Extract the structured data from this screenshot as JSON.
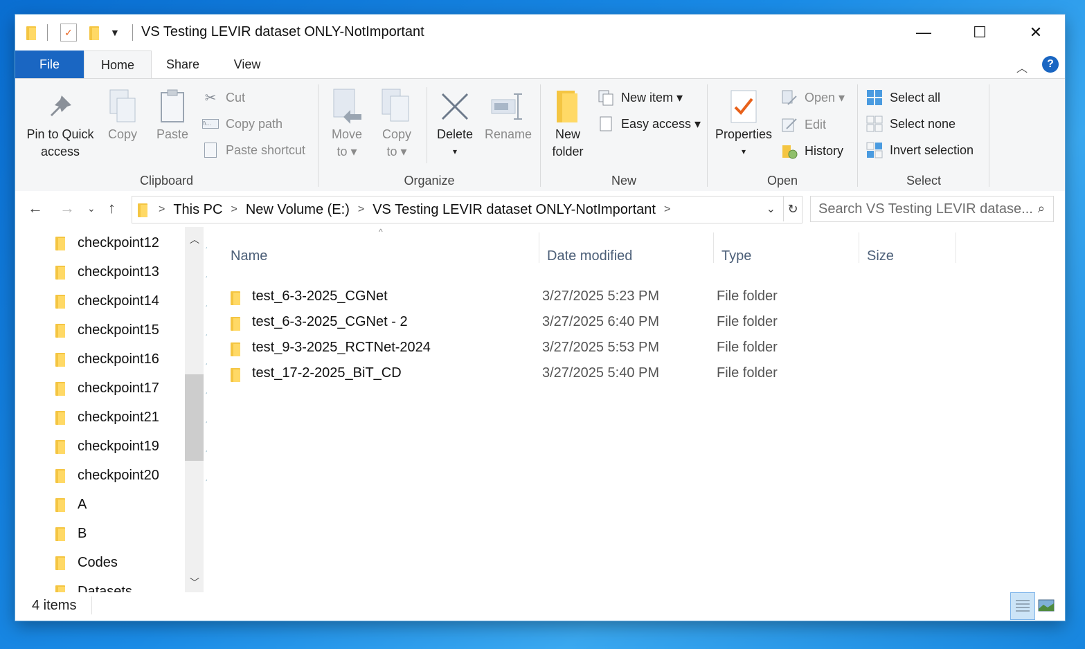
{
  "window": {
    "title": "VS Testing LEVIR dataset ONLY-NotImportant",
    "controls": {
      "minimize": "—",
      "maximize": "☐",
      "close": "✕"
    }
  },
  "tabs": {
    "file": "File",
    "home": "Home",
    "share": "Share",
    "view": "View",
    "help": "?"
  },
  "ribbon": {
    "clipboard": {
      "label": "Clipboard",
      "pin_line1": "Pin to Quick",
      "pin_line2": "access",
      "copy": "Copy",
      "paste": "Paste",
      "cut": "Cut",
      "copy_path": "Copy path",
      "paste_shortcut": "Paste shortcut"
    },
    "organize": {
      "label": "Organize",
      "move_line1": "Move",
      "move_line2": "to ▾",
      "copy_line1": "Copy",
      "copy_line2": "to ▾",
      "delete_line1": "Delete",
      "delete_line2": "▾",
      "rename": "Rename"
    },
    "new": {
      "label": "New",
      "new_folder_line1": "New",
      "new_folder_line2": "folder",
      "new_item": "New item ▾",
      "easy_access": "Easy access ▾"
    },
    "open": {
      "label": "Open",
      "properties_line1": "Properties",
      "properties_line2": "▾",
      "open": "Open ▾",
      "edit": "Edit",
      "history": "History"
    },
    "select": {
      "label": "Select",
      "select_all": "Select all",
      "select_none": "Select none",
      "invert": "Invert selection"
    }
  },
  "address": {
    "crumbs": [
      "This PC",
      "New Volume (E:)",
      "VS Testing LEVIR dataset ONLY-NotImportant"
    ],
    "search_placeholder": "Search VS Testing LEVIR datase..."
  },
  "navpane": {
    "items": [
      {
        "label": "checkpoint12",
        "pinned": true
      },
      {
        "label": "checkpoint13",
        "pinned": true
      },
      {
        "label": "checkpoint14",
        "pinned": true
      },
      {
        "label": "checkpoint15",
        "pinned": true
      },
      {
        "label": "checkpoint16",
        "pinned": true
      },
      {
        "label": "checkpoint17",
        "pinned": true
      },
      {
        "label": "checkpoint21",
        "pinned": true
      },
      {
        "label": "checkpoint19",
        "pinned": true
      },
      {
        "label": "checkpoint20",
        "pinned": true
      },
      {
        "label": "A",
        "pinned": false
      },
      {
        "label": "B",
        "pinned": false
      },
      {
        "label": "Codes",
        "pinned": false
      },
      {
        "label": "Datasets",
        "pinned": false
      }
    ]
  },
  "columns": {
    "name": "Name",
    "date": "Date modified",
    "type": "Type",
    "size": "Size"
  },
  "files": [
    {
      "name": "test_6-3-2025_CGNet",
      "date": "3/27/2025 5:23 PM",
      "type": "File folder",
      "size": ""
    },
    {
      "name": "test_6-3-2025_CGNet - 2",
      "date": "3/27/2025 6:40 PM",
      "type": "File folder",
      "size": ""
    },
    {
      "name": "test_9-3-2025_RCTNet-2024",
      "date": "3/27/2025 5:53 PM",
      "type": "File folder",
      "size": ""
    },
    {
      "name": "test_17-2-2025_BiT_CD",
      "date": "3/27/2025 5:40 PM",
      "type": "File folder",
      "size": ""
    }
  ],
  "status": {
    "items": "4 items"
  },
  "colors": {
    "file_tab": "#1a66c2",
    "ribbon_bg": "#f5f6f7",
    "folder": "#f4c542",
    "header_text": "#4c5f78"
  }
}
